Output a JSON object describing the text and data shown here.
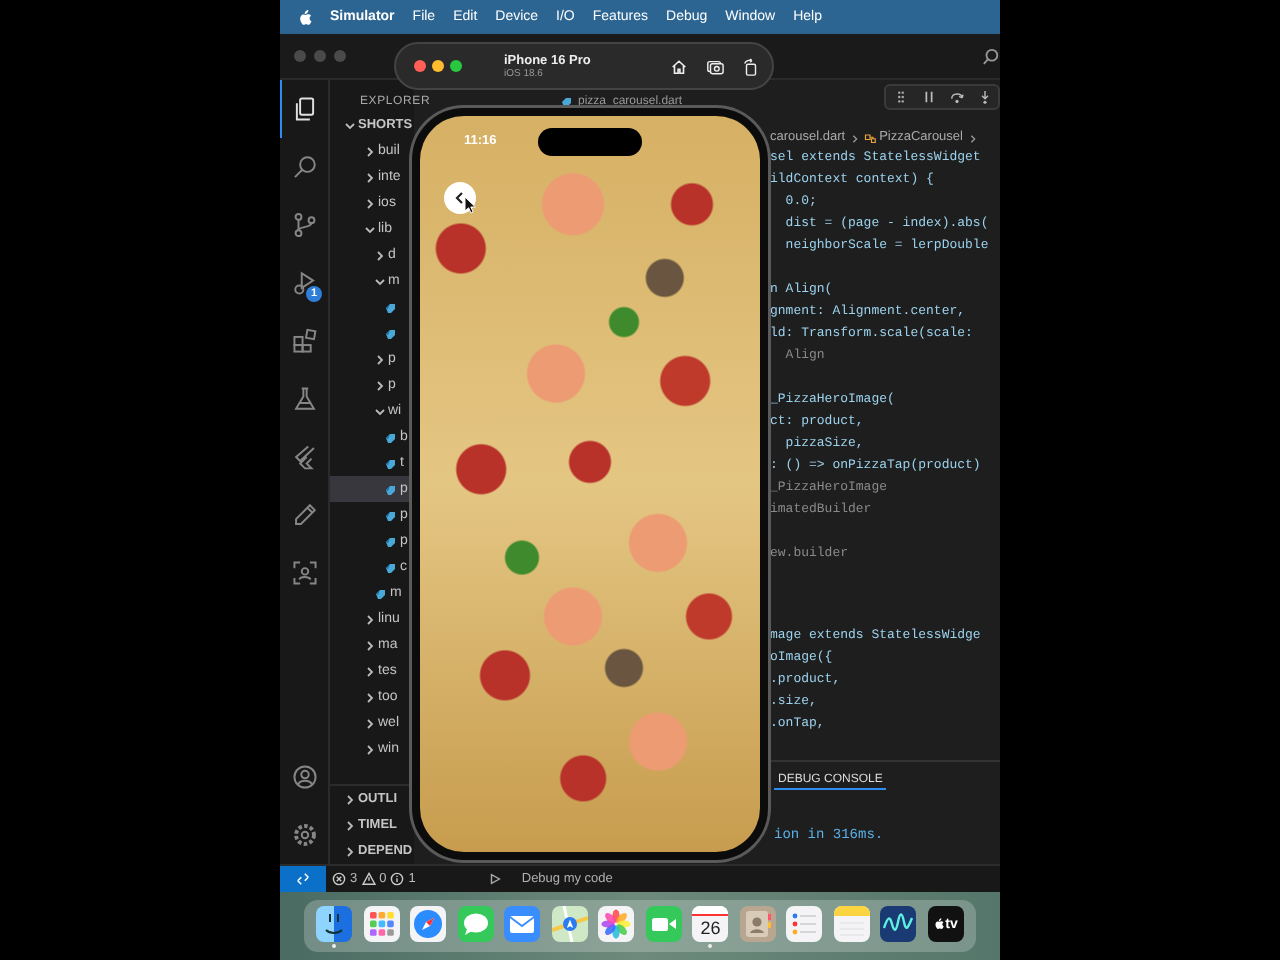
{
  "menu_bar": {
    "app": "Simulator",
    "items": [
      "File",
      "Edit",
      "Device",
      "I/O",
      "Features",
      "Debug",
      "Window",
      "Help"
    ]
  },
  "simulator_toolbar": {
    "device": "iPhone 16 Pro",
    "os": "iOS 18.6"
  },
  "activity_bar": {
    "items": [
      {
        "kind": "files",
        "selected": true
      },
      {
        "kind": "search",
        "selected": false
      },
      {
        "kind": "source-control",
        "selected": false
      },
      {
        "kind": "run-debug",
        "selected": false,
        "badge": "1"
      },
      {
        "kind": "extensions",
        "selected": false
      },
      {
        "kind": "testing",
        "selected": false
      },
      {
        "kind": "flutter",
        "selected": false
      },
      {
        "kind": "pencil",
        "selected": false
      },
      {
        "kind": "remote",
        "selected": false
      }
    ],
    "bottom": [
      {
        "kind": "account"
      },
      {
        "kind": "settings"
      }
    ]
  },
  "sidebar": {
    "title": "EXPLORER",
    "workspace": {
      "label": "SHORTS",
      "expanded": true
    },
    "tree": [
      {
        "kind": "folder",
        "label": "buil",
        "expanded": false,
        "selected": false
      },
      {
        "kind": "folder",
        "label": "inte",
        "expanded": false,
        "selected": false
      },
      {
        "kind": "folder",
        "label": "ios",
        "expanded": false,
        "selected": false
      },
      {
        "kind": "folder",
        "label": "lib",
        "expanded": true,
        "selected": false,
        "children": [
          {
            "kind": "folder",
            "label": "d",
            "expanded": false,
            "selected": false
          },
          {
            "kind": "folder",
            "label": "m",
            "expanded": true,
            "selected": false,
            "children": [
              {
                "kind": "file",
                "selected": false
              },
              {
                "kind": "file",
                "selected": false
              }
            ]
          },
          {
            "kind": "folder",
            "label": "p",
            "expanded": false,
            "selected": false
          },
          {
            "kind": "folder",
            "label": "p",
            "expanded": false,
            "selected": false
          },
          {
            "kind": "folder",
            "label": "wi",
            "expanded": true,
            "selected": false,
            "children": [
              {
                "kind": "file",
                "label": "b",
                "selected": false
              },
              {
                "kind": "file",
                "label": "t",
                "selected": false
              },
              {
                "kind": "file",
                "label": "p",
                "selected": true
              },
              {
                "kind": "file",
                "label": "p",
                "selected": false
              },
              {
                "kind": "file",
                "label": "p",
                "selected": false
              },
              {
                "kind": "file",
                "label": "c",
                "selected": false
              }
            ]
          },
          {
            "kind": "file",
            "label": "m",
            "selected": false
          }
        ]
      },
      {
        "kind": "folder",
        "label": "linu",
        "expanded": false,
        "selected": false
      },
      {
        "kind": "folder",
        "label": "ma",
        "expanded": false,
        "selected": false
      },
      {
        "kind": "folder",
        "label": "tes",
        "expanded": false,
        "selected": false
      },
      {
        "kind": "folder",
        "label": "too",
        "expanded": false,
        "selected": false
      },
      {
        "kind": "folder",
        "label": "wel",
        "expanded": false,
        "selected": false
      },
      {
        "kind": "folder",
        "label": "win",
        "expanded": false,
        "selected": false
      }
    ],
    "sections": [
      {
        "label": "OUTLI",
        "expanded": false
      },
      {
        "label": "TIMEL",
        "expanded": false
      },
      {
        "label": "DEPEND",
        "expanded": false
      }
    ]
  },
  "editor": {
    "tab": "pizza_carousel.dart",
    "breadcrumb": [
      "carousel.dart",
      "PizzaCarousel"
    ],
    "code_blocks": [
      [
        {
          "kind": "code",
          "text": "sel extends StatelessWidget"
        },
        {
          "kind": "code",
          "text": "ildContext context) {"
        },
        {
          "kind": "code",
          "text": "  0.0;"
        },
        {
          "kind": "code",
          "text": "  dist = (page - index).abs("
        },
        {
          "kind": "code",
          "text": "  neighborScale = lerpDouble"
        }
      ],
      [
        {
          "kind": "code",
          "text": "n Align("
        },
        {
          "kind": "code",
          "text": "gnment: Alignment.center,"
        },
        {
          "kind": "code",
          "text": "ld: Transform.scale(scale:"
        },
        {
          "kind": "comment",
          "text": "  Align"
        }
      ],
      [
        {
          "kind": "code",
          "text": "_PizzaHeroImage("
        },
        {
          "kind": "code",
          "text": "ct: product,"
        },
        {
          "kind": "code",
          "text": "  pizzaSize,"
        },
        {
          "kind": "code",
          "text": ": () => onPizzaTap(product)"
        },
        {
          "kind": "comment",
          "text": "_PizzaHeroImage"
        },
        {
          "kind": "comment",
          "text": "imatedBuilder"
        }
      ],
      [
        {
          "kind": "comment",
          "text": "ew.builder"
        }
      ],
      [
        {
          "kind": "code",
          "text": "mage extends StatelessWidge"
        },
        {
          "kind": "code",
          "text": "oImage({"
        },
        {
          "kind": "code",
          "text": ".product,"
        },
        {
          "kind": "code",
          "text": ".size,"
        },
        {
          "kind": "code",
          "text": ".onTap,"
        }
      ]
    ]
  },
  "panel": {
    "tab": "DEBUG CONSOLE",
    "output": "ion in 316ms."
  },
  "status_bar": {
    "errors": "3",
    "warnings": "0",
    "infos": "1",
    "debug": "Debug my code"
  },
  "phone": {
    "time": "11:16"
  },
  "dock": [
    {
      "kind": "face",
      "running": true
    },
    {
      "kind": "grid",
      "running": false
    },
    {
      "kind": "compass",
      "running": false
    },
    {
      "kind": "chat",
      "running": false
    },
    {
      "kind": "mail",
      "running": false
    },
    {
      "kind": "map",
      "running": false
    },
    {
      "kind": "flower",
      "running": false
    },
    {
      "kind": "video",
      "running": false
    },
    {
      "kind": "calendar",
      "running": true,
      "day": "26"
    },
    {
      "kind": "contacts",
      "running": false
    },
    {
      "kind": "list",
      "running": false
    },
    {
      "kind": "notes",
      "running": false
    },
    {
      "kind": "wave",
      "running": false
    },
    {
      "kind": "tv",
      "running": false,
      "label": "tv"
    }
  ]
}
